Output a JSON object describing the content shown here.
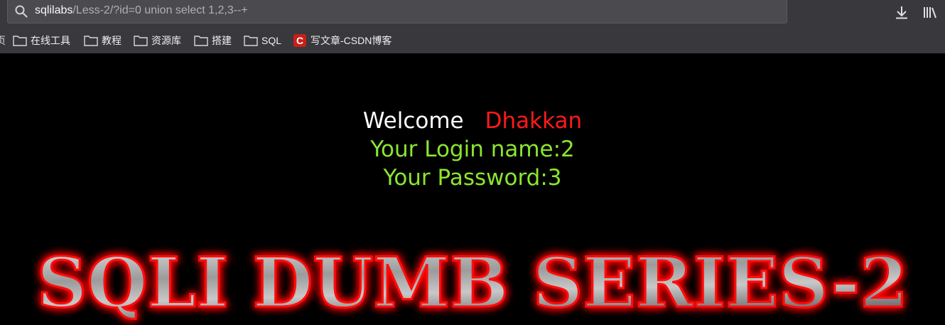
{
  "browser": {
    "url_host": "sqlilabs",
    "url_path": "/Less-2/?id=0 union select 1,2,3--+",
    "bookmark_edge": "页",
    "bookmarks": [
      {
        "label": "在线工具",
        "icon": "folder-icon"
      },
      {
        "label": "教程",
        "icon": "folder-icon"
      },
      {
        "label": "资源库",
        "icon": "folder-icon"
      },
      {
        "label": "搭建",
        "icon": "folder-icon"
      },
      {
        "label": "SQL",
        "icon": "folder-icon"
      },
      {
        "label": "写文章-CSDN博客",
        "icon": "csdn-logo-icon",
        "logo_letter": "C"
      }
    ]
  },
  "page": {
    "welcome": "Welcome",
    "username": "Dhakkan",
    "login_name": "Your Login name:2",
    "password": "Your Password:3",
    "banner": "SQLI DUMB SERIES-2"
  },
  "colors": {
    "background": "#000000",
    "welcome": "#ffffff",
    "username": "#ff1a1a",
    "result": "#8be62e",
    "banner_glow": "#ff0000"
  }
}
